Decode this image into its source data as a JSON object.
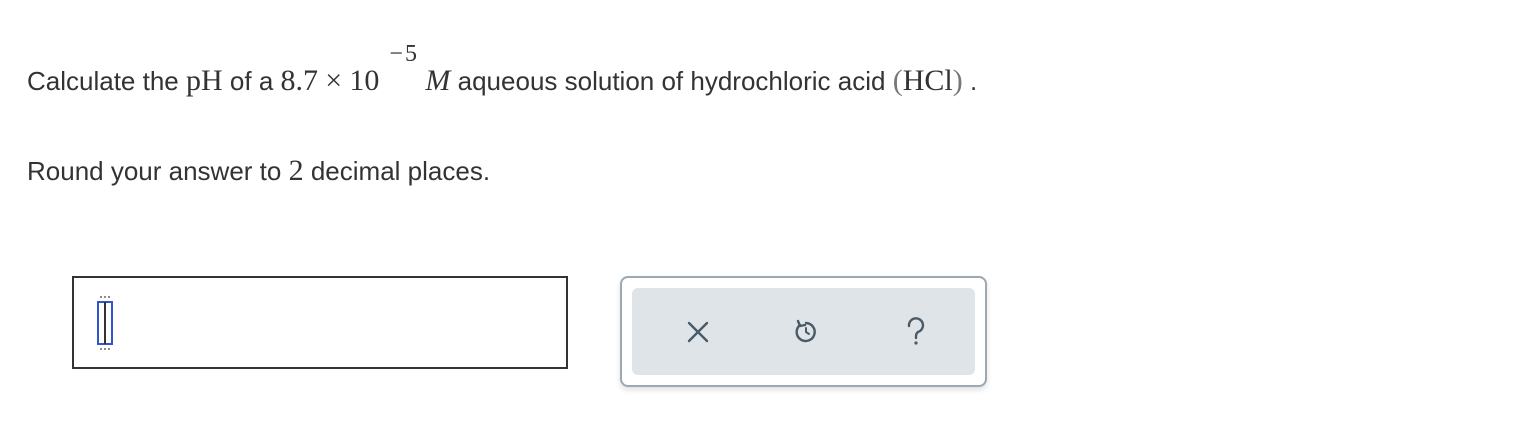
{
  "question": {
    "prefix": "Calculate the",
    "ph_symbol": "pH",
    "of_a": "of a",
    "coefficient": "8.7",
    "times": "×",
    "base": "10",
    "exponent": "−5",
    "unit": "M",
    "middle": "aqueous solution of hydrochloric acid",
    "paren_open": "(",
    "formula": "HCl",
    "paren_close": ")",
    "end": "."
  },
  "instruction": {
    "before": "Round your answer to",
    "number": "2",
    "after": "decimal places."
  },
  "answer": {
    "value": ""
  },
  "toolbar": {
    "clear_icon": "close-icon",
    "undo_icon": "undo-icon",
    "help_icon": "help-icon"
  },
  "colors": {
    "text": "#333333",
    "icon": "#4a5a66",
    "toolbar_bg": "#dfe4e8",
    "toolbar_border": "#9aa9b3",
    "cursor_blue": "#3355cc"
  }
}
